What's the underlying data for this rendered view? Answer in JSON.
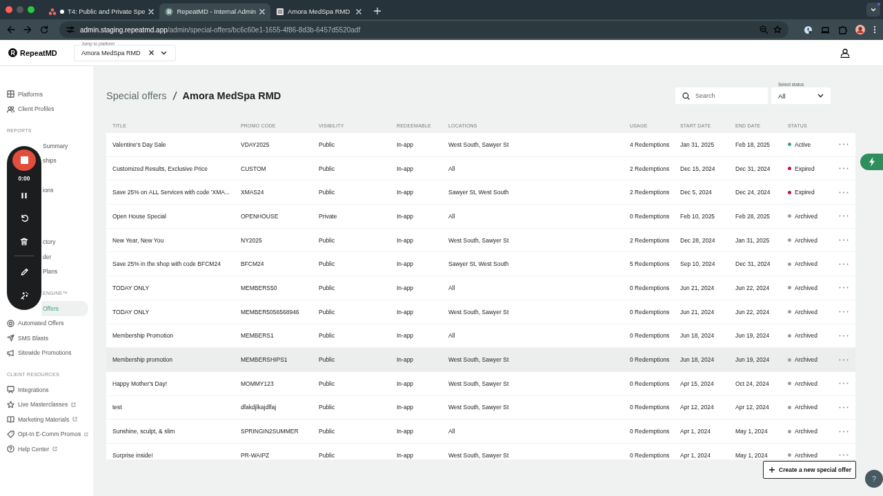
{
  "browser": {
    "tabs": [
      {
        "title": "T4: Public and Private Spe",
        "selected": false,
        "unsaved": true
      },
      {
        "title": "RepeatMD - Internal Admin",
        "selected": true,
        "unsaved": false
      },
      {
        "title": "Amora MedSpa RMD",
        "selected": false,
        "unsaved": false
      }
    ],
    "url_host": "admin.staging.repeatmd.app",
    "url_path": "/admin/special-offers/bc6c60e1-1655-4f86-8d3b-6457d5520adf"
  },
  "app_header": {
    "logo": "RepeatMD",
    "platform_picker": {
      "label": "Jump to platform",
      "value": "Amora MedSpa RMD"
    }
  },
  "sidebar": {
    "sections": [
      {
        "items": [
          {
            "label": "Platforms",
            "covered": false,
            "selected": false,
            "external": false
          },
          {
            "label": "Client Profiles",
            "covered": false,
            "selected": false,
            "external": false
          }
        ]
      },
      {
        "heading": "REPORTS",
        "items": [
          {
            "label": "Summary",
            "covered": true,
            "selected": false,
            "external": false
          },
          {
            "label": "ships",
            "covered": true,
            "selected": false,
            "external": false
          },
          {
            "label": "ions",
            "covered": true,
            "selected": false,
            "external": false
          }
        ]
      },
      {
        "items": [
          {
            "label": "ctory",
            "covered": true,
            "selected": false,
            "external": false
          },
          {
            "label": "der",
            "covered": true,
            "selected": false,
            "external": false
          },
          {
            "label": "Plans",
            "covered": true,
            "selected": false,
            "external": false
          }
        ]
      },
      {
        "heading": "ENGINE™",
        "heading_covered": true,
        "items": [
          {
            "label": "Offers",
            "covered": true,
            "selected": true,
            "external": false
          },
          {
            "label": "Automated Offers",
            "covered": false,
            "selected": false,
            "external": false
          },
          {
            "label": "SMS Blasts",
            "covered": false,
            "selected": false,
            "external": false
          },
          {
            "label": "Sitewide Promotions",
            "covered": false,
            "selected": false,
            "external": false
          }
        ]
      },
      {
        "heading": "CLIENT RESOURCES",
        "items": [
          {
            "label": "Integrations",
            "covered": false,
            "selected": false,
            "external": false
          },
          {
            "label": "Live Masterclasses",
            "covered": false,
            "selected": false,
            "external": true
          },
          {
            "label": "Marketing Materials",
            "covered": false,
            "selected": false,
            "external": true
          },
          {
            "label": "Opt-In E-Comm Promos",
            "covered": false,
            "selected": false,
            "external": true
          },
          {
            "label": "Help Center",
            "covered": false,
            "selected": false,
            "external": true
          }
        ]
      }
    ]
  },
  "recorder": {
    "time": "0:00"
  },
  "page": {
    "breadcrumb": [
      "Special offers",
      "Amora MedSpa RMD"
    ],
    "search": {
      "placeholder": "Search"
    },
    "status_filter": {
      "label": "Select status",
      "value": "All"
    },
    "create_button": "Create a new special offer",
    "help_button": "?"
  },
  "table": {
    "columns": [
      "TITLE",
      "PROMO CODE",
      "VISIBILITY",
      "REDEEMABLE",
      "LOCATIONS",
      "USAGE",
      "START DATE",
      "END DATE",
      "STATUS"
    ],
    "rows": [
      {
        "cells": [
          "Valentine's Day Sale",
          "VDAY2025",
          "Public",
          "In-app",
          "West South, Sawyer St",
          "4 Redemptions",
          "Jan 31, 2025",
          "Feb 18, 2025"
        ],
        "status": "Active",
        "color": "#3aa57a",
        "hovered": false
      },
      {
        "cells": [
          "Customized Results, Exclusive Price",
          "CUSTOM",
          "Public",
          "In-app",
          "All",
          "2 Redemptions",
          "Dec 15, 2024",
          "Dec 31, 2024"
        ],
        "status": "Expired",
        "color": "#c0143c",
        "hovered": false
      },
      {
        "cells": [
          "Save 25% on ALL Services with code 'XMA...",
          "XMAS24",
          "Public",
          "In-app",
          "Sawyer St, West South",
          "2 Redemptions",
          "Dec 5, 2024",
          "Dec 24, 2024"
        ],
        "status": "Expired",
        "color": "#c0143c",
        "hovered": false
      },
      {
        "cells": [
          "Open House Special",
          "OPENHOUSE",
          "Private",
          "In-app",
          "All",
          "0 Redemptions",
          "Feb 10, 2025",
          "Feb 28, 2025"
        ],
        "status": "Archived",
        "color": "#9e9e9e",
        "hovered": false
      },
      {
        "cells": [
          "New Year, New You",
          "NY2025",
          "Public",
          "In-app",
          "West South, Sawyer St",
          "2 Redemptions",
          "Dec 28, 2024",
          "Jan 31, 2025"
        ],
        "status": "Archived",
        "color": "#9e9e9e",
        "hovered": false
      },
      {
        "cells": [
          "Save 25% in the shop with code BFCM24",
          "BFCM24",
          "Public",
          "In-app",
          "Sawyer St, West South",
          "5 Redemptions",
          "Sep 10, 2024",
          "Dec 31, 2024"
        ],
        "status": "Archived",
        "color": "#9e9e9e",
        "hovered": false
      },
      {
        "cells": [
          "TODAY ONLY",
          "MEMBERS50",
          "Public",
          "In-app",
          "All",
          "0 Redemptions",
          "Jun 21, 2024",
          "Jun 22, 2024"
        ],
        "status": "Archived",
        "color": "#9e9e9e",
        "hovered": false
      },
      {
        "cells": [
          "TODAY ONLY",
          "MEMBER5056568946",
          "Public",
          "In-app",
          "West South, Sawyer St",
          "0 Redemptions",
          "Jun 21, 2024",
          "Jun 22, 2024"
        ],
        "status": "Archived",
        "color": "#9e9e9e",
        "hovered": false
      },
      {
        "cells": [
          "Membership Promotion",
          "MEMBERS1",
          "Public",
          "In-app",
          "All",
          "0 Redemptions",
          "Jun 18, 2024",
          "Jun 19, 2024"
        ],
        "status": "Archived",
        "color": "#9e9e9e",
        "hovered": false
      },
      {
        "cells": [
          "Membership promotion",
          "MEMBERSHIPS1",
          "Public",
          "In-app",
          "West South, Sawyer St",
          "0 Redemptions",
          "Jun 18, 2024",
          "Jun 19, 2024"
        ],
        "status": "Archived",
        "color": "#9e9e9e",
        "hovered": true
      },
      {
        "cells": [
          "Happy Mother's Day!",
          "MOMMY123",
          "Public",
          "In-app",
          "West South, Sawyer St",
          "0 Redemptions",
          "Apr 15, 2024",
          "Oct 24, 2024"
        ],
        "status": "Archived",
        "color": "#9e9e9e",
        "hovered": false
      },
      {
        "cells": [
          "test",
          "dfakdjlkajdlfaj",
          "Public",
          "In-app",
          "West South, Sawyer St",
          "0 Redemptions",
          "Apr 12, 2024",
          "Apr 12, 2024"
        ],
        "status": "Archived",
        "color": "#9e9e9e",
        "hovered": false
      },
      {
        "cells": [
          "Sunshine, sculpt, & slim",
          "SPRINGIN2SUMMER",
          "Public",
          "In-app",
          "All",
          "0 Redemptions",
          "Apr 1, 2024",
          "May 1, 2024"
        ],
        "status": "Archived",
        "color": "#9e9e9e",
        "hovered": false
      },
      {
        "cells": [
          "Surprise inside!",
          "PR-WAIPZ",
          "Public",
          "In-app",
          "West South, Sawyer St",
          "0 Redemptions",
          "Apr 1, 2024",
          "May 1, 2024"
        ],
        "status": "Archived",
        "color": "#9e9e9e",
        "hovered": false
      }
    ]
  }
}
